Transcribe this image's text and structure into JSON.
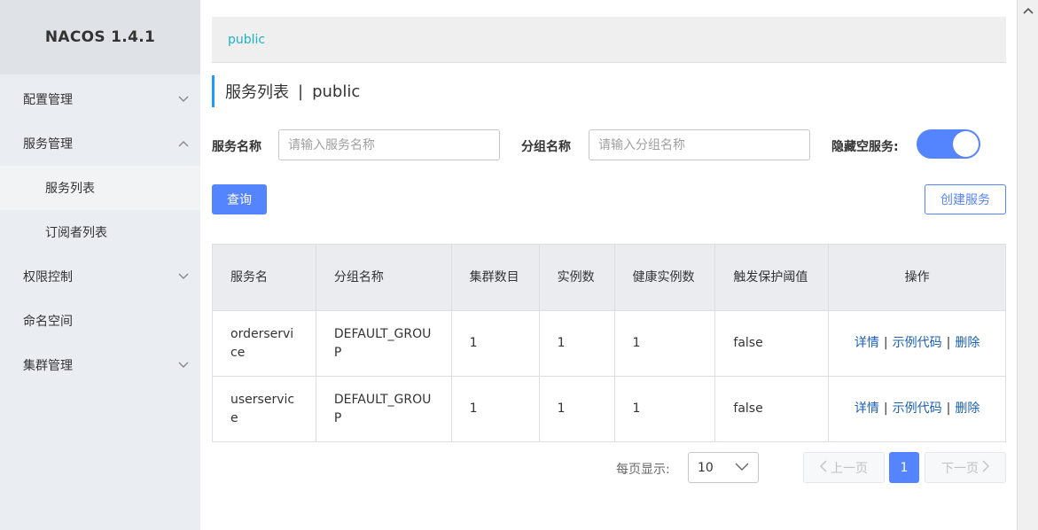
{
  "sidebar": {
    "brand": "NACOS 1.4.1",
    "items": [
      {
        "label": "配置管理",
        "icon": "chevron-down-icon"
      },
      {
        "label": "服务管理",
        "icon": "chevron-up-icon"
      },
      {
        "label": "服务列表"
      },
      {
        "label": "订阅者列表"
      },
      {
        "label": "权限控制",
        "icon": "chevron-down-icon"
      },
      {
        "label": "命名空间"
      },
      {
        "label": "集群管理",
        "icon": "chevron-down-icon"
      }
    ]
  },
  "namespace_bar": {
    "namespace": "public"
  },
  "page": {
    "title": "服务列表",
    "separator": "|",
    "namespace": "public"
  },
  "search": {
    "service_name_label": "服务名称",
    "service_name_placeholder": "请输入服务名称",
    "group_name_label": "分组名称",
    "group_name_placeholder": "请输入分组名称",
    "hide_empty_label": "隐藏空服务:",
    "hide_empty_on": true,
    "query_label": "查询",
    "create_label": "创建服务"
  },
  "table": {
    "headers": [
      "服务名",
      "分组名称",
      "集群数目",
      "实例数",
      "健康实例数",
      "触发保护阈值",
      "操作"
    ],
    "rows": [
      {
        "service": "orderservice",
        "group": "DEFAULT_GROUP",
        "clusters": "1",
        "instances": "1",
        "healthy": "1",
        "threshold": "false"
      },
      {
        "service": "userservice",
        "group": "DEFAULT_GROUP",
        "clusters": "1",
        "instances": "1",
        "healthy": "1",
        "threshold": "false"
      }
    ],
    "ops": {
      "detail": "详情",
      "sample_code": "示例代码",
      "delete": "删除",
      "separator": "|"
    }
  },
  "pagination": {
    "per_page_label": "每页显示:",
    "page_size": "10",
    "prev_label": "上一页",
    "next_label": "下一页",
    "current_page": "1"
  },
  "colors": {
    "primary": "#5584ff",
    "accent_bar": "#209bfa",
    "namespace_link": "#1fb3c6",
    "sidebar_bg": "#eaedf1",
    "op_link": "#1a5fb4"
  }
}
